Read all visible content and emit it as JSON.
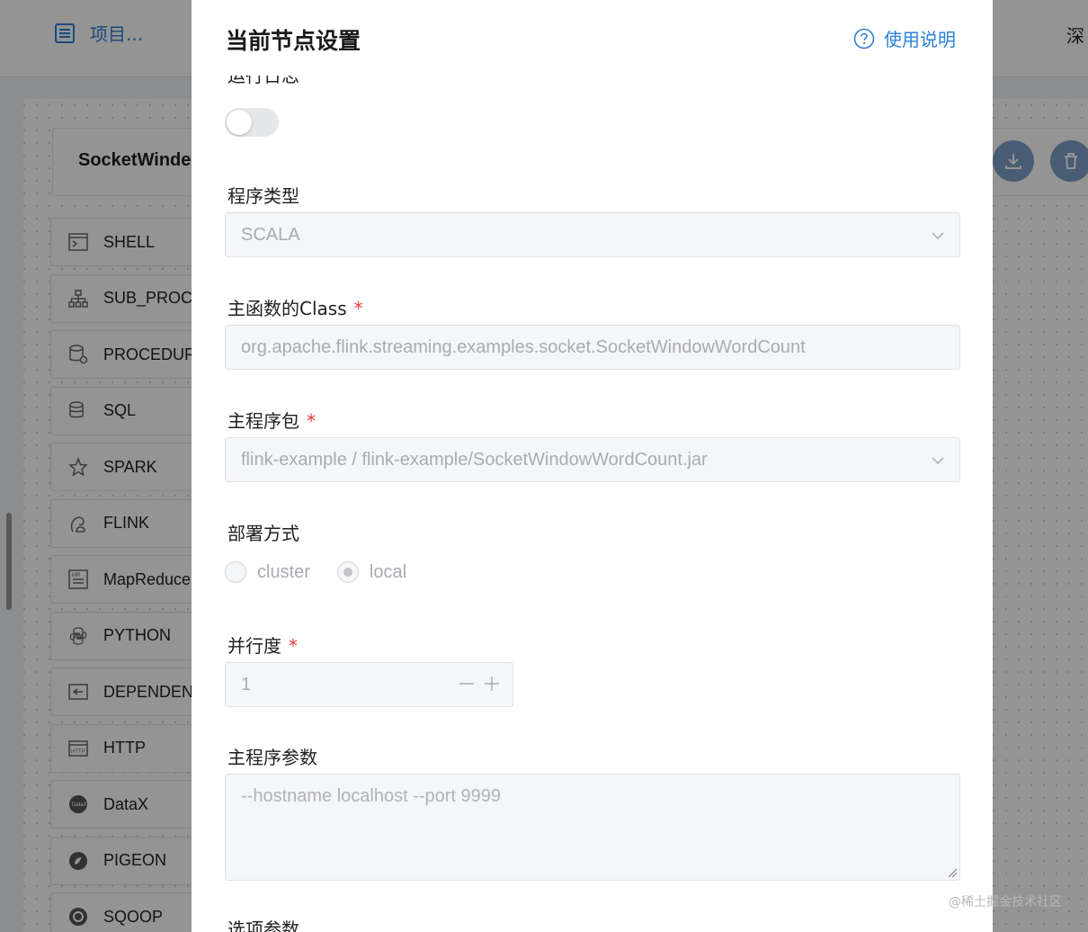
{
  "topbar": {
    "project_label": "项目...",
    "right_text": "深"
  },
  "workflow": {
    "name": "SocketWinde"
  },
  "sidebar": {
    "items": [
      {
        "label": "SHELL",
        "icon": "terminal-icon"
      },
      {
        "label": "SUB_PROCE",
        "icon": "sitemap-icon"
      },
      {
        "label": "PROCEDUR",
        "icon": "database-gear-icon"
      },
      {
        "label": "SQL",
        "icon": "database-sql-icon"
      },
      {
        "label": "SPARK",
        "icon": "spark-star-icon"
      },
      {
        "label": "FLINK",
        "icon": "squirrel-icon"
      },
      {
        "label": "MapReduce",
        "icon": "mapreduce-icon"
      },
      {
        "label": "PYTHON",
        "icon": "python-icon"
      },
      {
        "label": "DEPENDENT",
        "icon": "dependent-icon"
      },
      {
        "label": "HTTP",
        "icon": "http-icon"
      },
      {
        "label": "DataX",
        "icon": "datax-icon"
      },
      {
        "label": "PIGEON",
        "icon": "pigeon-icon"
      },
      {
        "label": "SQOOP",
        "icon": "sqoop-icon"
      }
    ]
  },
  "drawer": {
    "title": "当前节点设置",
    "help_label": "使用说明",
    "fields": {
      "prev_label": "运行日志",
      "program_type": {
        "label": "程序类型",
        "value": "SCALA"
      },
      "main_class": {
        "label": "主函数的Class",
        "required": "*",
        "value": "org.apache.flink.streaming.examples.socket.SocketWindowWordCount"
      },
      "main_package": {
        "label": "主程序包",
        "required": "*",
        "value": "flink-example / flink-example/SocketWindowWordCount.jar"
      },
      "deploy_mode": {
        "label": "部署方式",
        "options": [
          "cluster",
          "local"
        ],
        "selected": "local"
      },
      "parallelism": {
        "label": "并行度",
        "required": "*",
        "value": "1"
      },
      "main_args": {
        "label": "主程序参数",
        "placeholder": "--hostname localhost --port 9999"
      },
      "option_params": {
        "label": "选项参数"
      }
    }
  },
  "watermark": "@稀土掘金技术社区",
  "colors": {
    "accent": "#2b7fd8",
    "required": "#e53935"
  }
}
